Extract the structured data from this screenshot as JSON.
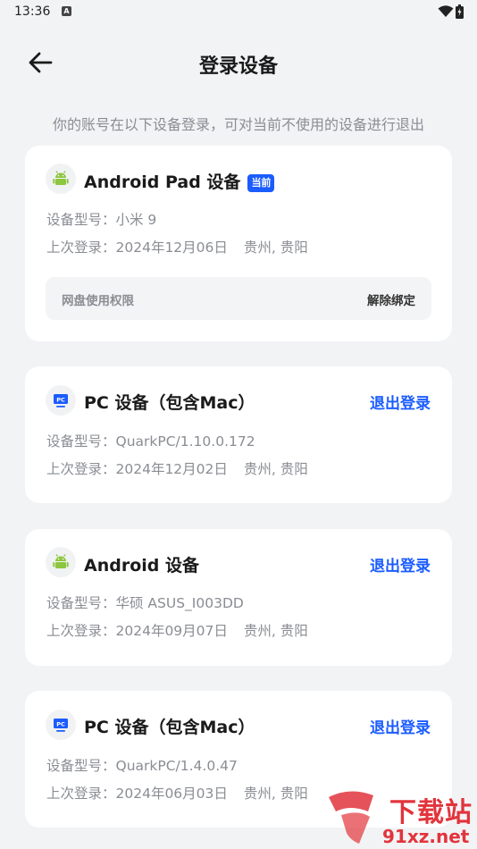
{
  "status": {
    "time": "13:36",
    "notif_icon": "A"
  },
  "header": {
    "title": "登录设备"
  },
  "subtitle": "你的账号在以下设备登录，可对当前不使用的设备进行退出",
  "devices": [
    {
      "icon": "android-icon",
      "name": "Android Pad 设备",
      "badge": "当前",
      "model": "设备型号：小米 9",
      "last_login": "上次登录：2024年12月06日",
      "location": "贵州, 贵阳",
      "perm_label": "网盘使用权限",
      "unbind_label": "解除绑定"
    },
    {
      "icon": "pc-icon",
      "name": "PC 设备（包含Mac）",
      "action": "退出登录",
      "model": "设备型号：QuarkPC/1.10.0.172",
      "last_login": "上次登录：2024年12月02日",
      "location": "贵州, 贵阳"
    },
    {
      "icon": "android-icon",
      "name": "Android 设备",
      "action": "退出登录",
      "model": "设备型号：华硕 ASUS_I003DD",
      "last_login": "上次登录：2024年09月07日",
      "location": "贵州, 贵阳"
    },
    {
      "icon": "pc-icon",
      "name": "PC 设备（包含Mac）",
      "action": "退出登录",
      "model": "设备型号：QuarkPC/1.4.0.47",
      "last_login": "上次登录：2024年06月03日",
      "location": "贵州, 贵阳"
    }
  ],
  "watermark": {
    "line1": "下载站",
    "line2": "91xz.net"
  },
  "colors": {
    "accent": "#1b5cff",
    "android": "#8dc63f",
    "pc": "#1b5cff",
    "watermark": "#e2343c"
  }
}
